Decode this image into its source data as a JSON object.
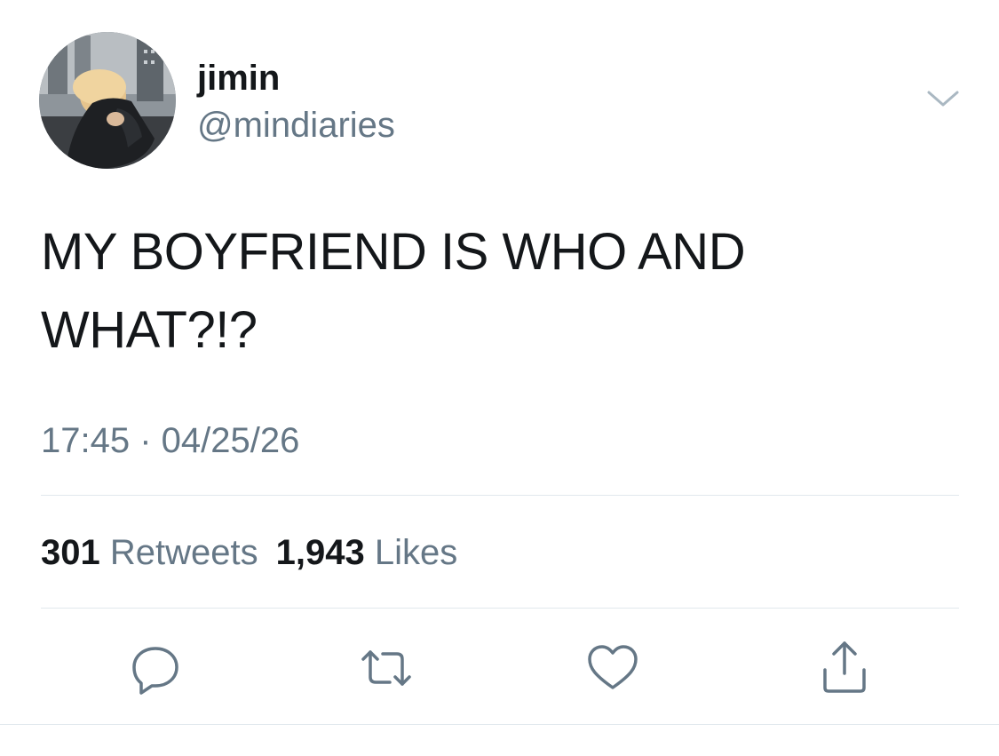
{
  "user": {
    "display_name": "jimin",
    "handle": "@mindiaries"
  },
  "tweet": {
    "text": "MY BOYFRIEND IS WHO AND WHAT?!?",
    "timestamp": "17:45 · 04/25/26"
  },
  "stats": {
    "retweets_count": "301",
    "retweets_label": "Retweets",
    "likes_count": "1,943",
    "likes_label": "Likes"
  },
  "icons": {
    "menu": "chevron-down-icon",
    "reply": "reply-icon",
    "retweet": "retweet-icon",
    "like": "heart-icon",
    "share": "share-icon"
  },
  "colors": {
    "text_primary": "#14171a",
    "text_secondary": "#657786",
    "divider": "#e1e8ed"
  }
}
